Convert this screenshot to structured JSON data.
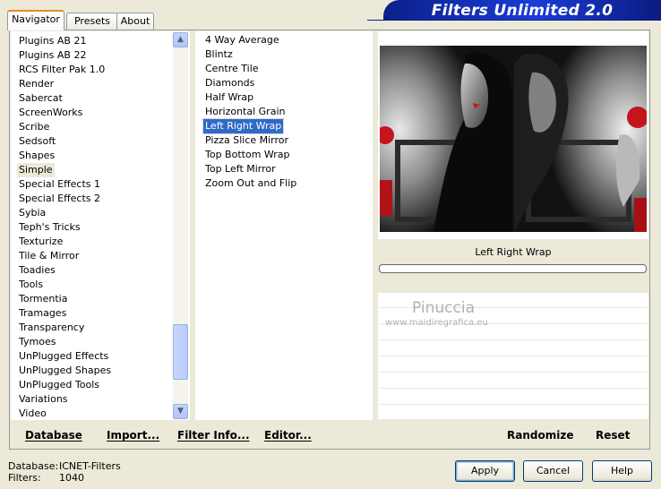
{
  "tabs": [
    "Navigator",
    "Presets",
    "About"
  ],
  "app_title": "Filters Unlimited 2.0",
  "categories": [
    "Plugins AB 21",
    "Plugins AB 22",
    "RCS Filter Pak 1.0",
    "Render",
    "Sabercat",
    "ScreenWorks",
    "Scribe",
    "Sedsoft",
    "Shapes",
    "Simple",
    "Special Effects 1",
    "Special Effects 2",
    "Sybia",
    "Teph's Tricks",
    "Texturize",
    "Tile & Mirror",
    "Toadies",
    "Tools",
    "Tormentia",
    "Tramages",
    "Transparency",
    "Tymoes",
    "UnPlugged Effects",
    "UnPlugged Shapes",
    "UnPlugged Tools",
    "Variations",
    "Video"
  ],
  "selected_category": "Simple",
  "filters": [
    "4 Way Average",
    "Blintz",
    "Centre Tile",
    "Diamonds",
    "Half Wrap",
    "Horizontal Grain",
    "Left Right Wrap",
    "Pizza Slice Mirror",
    "Top Bottom Wrap",
    "Top Left Mirror",
    "Zoom Out and Flip"
  ],
  "selected_filter": "Left Right Wrap",
  "info": {
    "filter_name": "Left Right Wrap",
    "progress": 0
  },
  "watermark": {
    "name": "Pinuccia",
    "url": "www.maidiregrafica.eu"
  },
  "bottom_links": {
    "database": "Database",
    "import": "Import...",
    "filter_info": "Filter Info...",
    "editor": "Editor...",
    "randomize": "Randomize",
    "reset": "Reset"
  },
  "status": {
    "database_label": "Database:",
    "database_value": "ICNET-Filters",
    "filters_label": "Filters:",
    "filters_value": "1040"
  },
  "buttons": {
    "apply": "Apply",
    "cancel": "Cancel",
    "help": "Help"
  },
  "colors": {
    "selection": "#316ac5",
    "banner": "#1a3dd8",
    "face": "#ece9d8"
  },
  "scroll_icons": {
    "up": "chevron-up-icon",
    "down": "chevron-down-icon"
  }
}
